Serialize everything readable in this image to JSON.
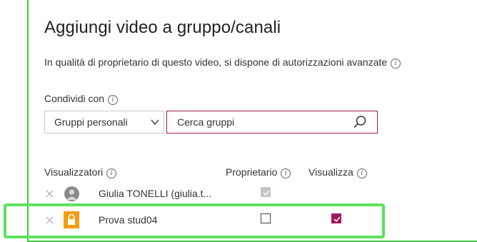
{
  "dialog": {
    "title": "Aggiungi video a gruppo/canali",
    "subtitle": "In qualità di proprietario di questo video, si dispone di autorizzazioni avanzate"
  },
  "share": {
    "label": "Condividi con",
    "dropdown_value": "Gruppi personali",
    "search_placeholder": "Cerca gruppi"
  },
  "table": {
    "headers": {
      "viewers": "Visualizzatori",
      "owner": "Proprietario",
      "view": "Visualizza"
    },
    "rows": [
      {
        "name": "Giulia TONELLI (giulia.t...",
        "icon": "user-avatar-icon",
        "owner_checked": true,
        "owner_disabled": true,
        "view_checked": false
      },
      {
        "name": "Prova stud04",
        "icon": "lock-icon",
        "owner_checked": false,
        "owner_disabled": false,
        "view_checked": true
      }
    ]
  },
  "colors": {
    "accent": "#a0185a",
    "highlight": "#5ce25c",
    "panel_border": "#3cc63c",
    "lock_bg": "#f39c12"
  }
}
